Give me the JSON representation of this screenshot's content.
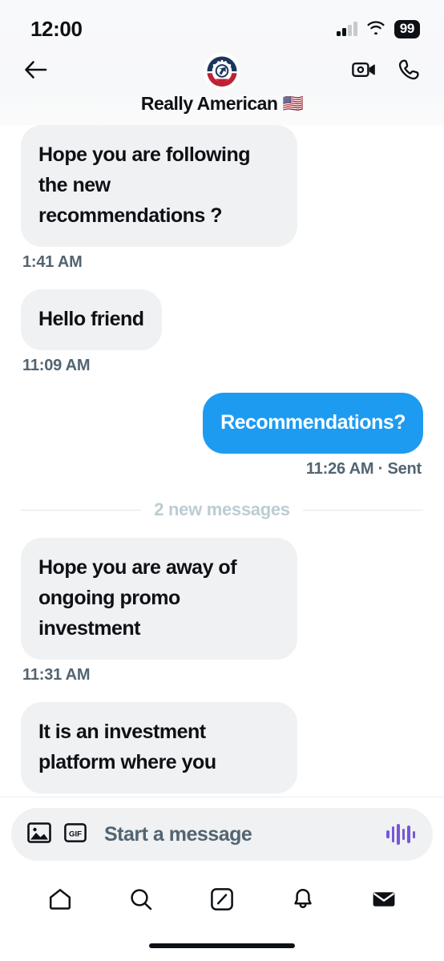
{
  "status_bar": {
    "time": "12:00",
    "battery_level": "99",
    "signal_icon": "cellular-signal-icon",
    "wifi_icon": "wifi-icon"
  },
  "header": {
    "back_icon": "back-arrow-icon",
    "avatar_icon": "really-american-avatar",
    "title": "Really American",
    "title_emoji": "🇺🇸",
    "video_call_icon": "video-camera-icon",
    "voice_call_icon": "phone-icon",
    "background_color": "#f7f8f9"
  },
  "thread": {
    "divider_label": "2 new messages",
    "messages": [
      {
        "direction": "inbound",
        "text": "Hope you are following the new recommendations ?",
        "stamp": "1:41 AM"
      },
      {
        "direction": "inbound",
        "text": "Hello friend",
        "stamp": "11:09 AM"
      },
      {
        "direction": "outbound",
        "text": "Recommendations?",
        "stamp": "11:26 AM · Sent"
      },
      {
        "direction": "inbound",
        "text": "Hope you are away of ongoing promo investment",
        "stamp": "11:31 AM"
      },
      {
        "direction": "inbound",
        "text": "It is an investment platform where you",
        "stamp": ""
      }
    ],
    "inbound_bubble_color": "#eff1f2",
    "outbound_bubble_color": "#1d9bf0",
    "stamp_color": "#536471",
    "divider_color": "#bcccd4"
  },
  "composer": {
    "image_icon": "image-icon",
    "gif_icon": "gif-icon",
    "gif_label": "GIF",
    "placeholder": "Start a message",
    "audio_icon": "audio-waveform-icon",
    "audio_color": "#7856d6",
    "background_color": "#eff1f2"
  },
  "bottom_nav": {
    "items": [
      {
        "name": "home",
        "icon": "home-icon",
        "active": false
      },
      {
        "name": "search",
        "icon": "search-icon",
        "active": false
      },
      {
        "name": "grok",
        "icon": "grok-icon",
        "active": false
      },
      {
        "name": "notifications",
        "icon": "bell-icon",
        "active": false
      },
      {
        "name": "messages",
        "icon": "envelope-icon",
        "active": true
      }
    ]
  }
}
